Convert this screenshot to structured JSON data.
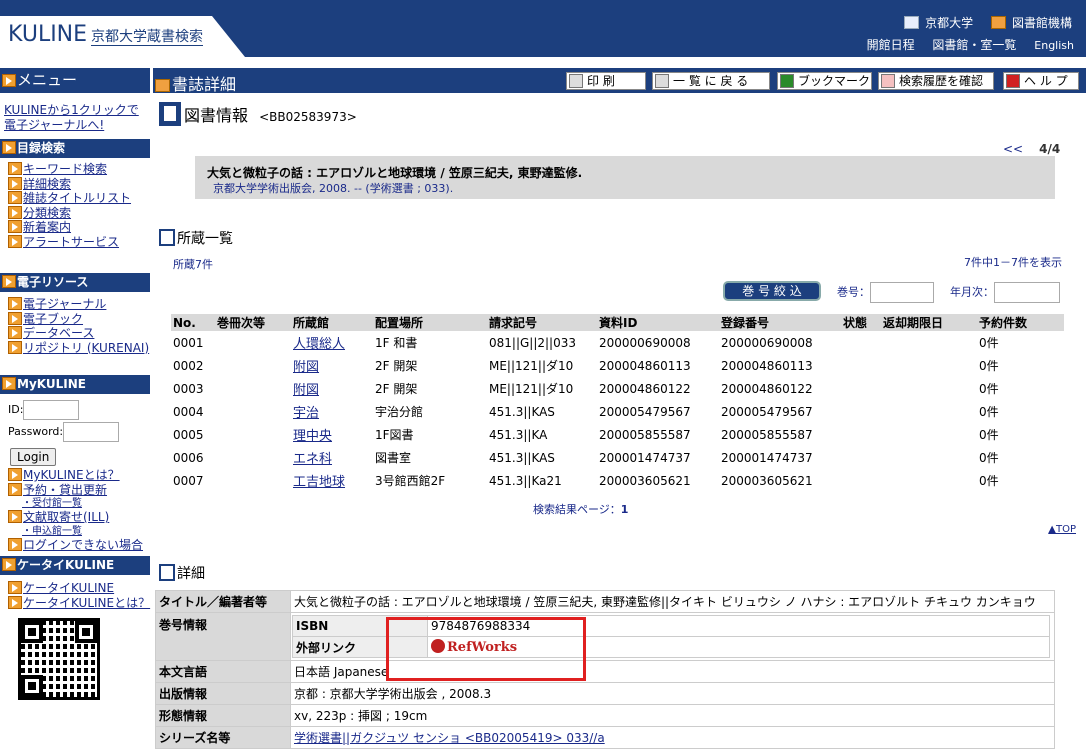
{
  "header": {
    "logo_main": "KULINE",
    "logo_sub": "京都大学蔵書検索",
    "link_univ": "京都大学",
    "link_lib": "図書館機構",
    "link_hours": "開館日程",
    "link_rooms": "図書館・室一覧",
    "link_english": "English"
  },
  "nav": {
    "menu_title": "メニュー",
    "ej_promo": "KULINEから1クリックで電子ジャーナルへ!",
    "catalog_title": "目録検索",
    "catalog_items": [
      "キーワード検索",
      "詳細検索",
      "雑誌タイトルリスト",
      "分類検索",
      "新着案内",
      "アラートサービス"
    ],
    "eres_title": "電子リソース",
    "eres_items": [
      "電子ジャーナル",
      "電子ブック",
      "データベース",
      "リポジトリ (KURENAI)"
    ],
    "my_title": "MyKULINE",
    "id_label": "ID:",
    "pw_label": "Password:",
    "login_button": "Login",
    "my_links": [
      "MyKULINEとは？",
      "予約・貸出更新"
    ],
    "my_sub1": "・受付館一覧",
    "ill_link": "文献取寄せ(ILL)",
    "my_sub2": "・申込館一覧",
    "cant_login": "ログインできない場合",
    "mobile_title": "ケータイKULINE",
    "mobile_items": [
      "ケータイKULINE",
      "ケータイKULINEとは？"
    ]
  },
  "titlebar": {
    "title": "書誌詳細",
    "btn_print": "印 刷",
    "btn_back": "一 覧 に 戻 る",
    "btn_bookmark": "ブックマーク",
    "btn_history": "検索履歴を確認",
    "btn_help": "ヘ ル プ"
  },
  "record": {
    "section_title": "図書情報",
    "record_id": "<BB02583973>",
    "pager_prev": "<<",
    "pager_pos": "4/4",
    "bib_title": "大気と微粒子の話 : エアロゾルと地球環境 / 笠原三紀夫, 東野達監修.",
    "bib_pub": "京都大学学術出版会, 2008. -- (学術選書 ; 033)."
  },
  "holdings": {
    "section_title": "所蔵一覧",
    "count_text": "所蔵7件",
    "range_text": "7件中1－7件を表示",
    "filter_button": "巻 号 絞 込",
    "vol_label": "巻号：",
    "year_label": "年月次：",
    "columns": [
      "No.",
      "巻冊次等",
      "所蔵館",
      "配置場所",
      "請求記号",
      "資料ID",
      "登録番号",
      "状態",
      "返却期限日",
      "予約件数"
    ],
    "rows": [
      [
        "0001",
        "",
        "人環総人",
        "1F 和書",
        "081||G||2||033",
        "200000690008",
        "200000690008",
        "",
        "",
        "0件"
      ],
      [
        "0002",
        "",
        "附図",
        "2F 開架",
        "ME||121||ダ10",
        "200004860113",
        "200004860113",
        "",
        "",
        "0件"
      ],
      [
        "0003",
        "",
        "附図",
        "2F 開架",
        "ME||121||ダ10",
        "200004860122",
        "200004860122",
        "",
        "",
        "0件"
      ],
      [
        "0004",
        "",
        "宇治",
        "宇治分館",
        "451.3||KAS",
        "200005479567",
        "200005479567",
        "",
        "",
        "0件"
      ],
      [
        "0005",
        "",
        "理中央",
        "1F図書",
        "451.3||KA",
        "200005855587",
        "200005855587",
        "",
        "",
        "0件"
      ],
      [
        "0006",
        "",
        "エネ科",
        "図書室",
        "451.3||KAS",
        "200001474737",
        "200001474737",
        "",
        "",
        "0件"
      ],
      [
        "0007",
        "",
        "工吉地球",
        "3号館西館2F",
        "451.3||Ka21",
        "200003605621",
        "200003605621",
        "",
        "",
        "0件"
      ]
    ],
    "result_page": "検索結果ページ：",
    "result_page_num": "1",
    "top_link": "▲TOP"
  },
  "detail": {
    "section_title": "詳細",
    "title_label": "タイトル／編著者等",
    "title_value": "大気と微粒子の話 : エアロゾルと地球環境 / 笠原三紀夫, 東野達監修||タイキト ビリュウシ ノ ハナシ : エアロゾルト チキュウ カンキョウ",
    "vol_label": "巻号情報",
    "isbn_label": "ISBN",
    "isbn_value": "9784876988334",
    "extlink_label": "外部リンク",
    "refworks": "RefWorks",
    "lang_label": "本文言語",
    "lang_value": "日本語 Japanese",
    "pub_label": "出版情報",
    "pub_value": "京都 : 京都大学学術出版会 , 2008.3",
    "form_label": "形態情報",
    "form_value": "xv, 223p : 挿図 ; 19cm",
    "series_label": "シリーズ名等",
    "series_value": "学術選書||ガクジュツ センショ <BB02005419> 033//a"
  },
  "colors": {
    "navy": "#1c3f7e",
    "highlight": "#e02020",
    "link": "#1a2a8a"
  }
}
